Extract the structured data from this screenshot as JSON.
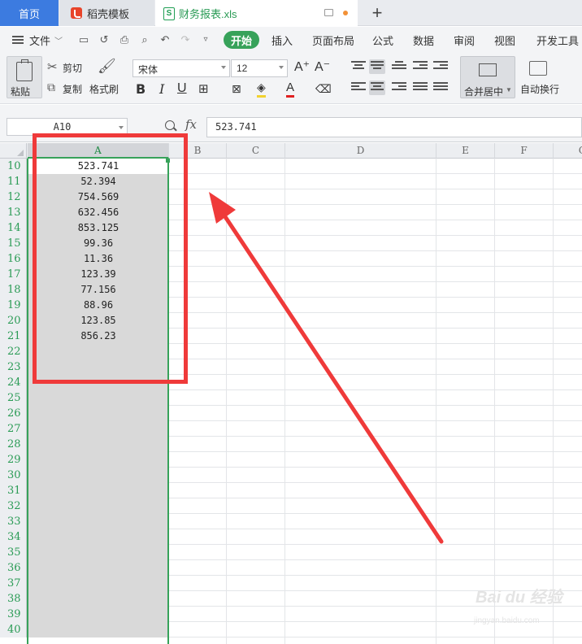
{
  "tabs": {
    "home": "首页",
    "template": "稻壳模板",
    "file": "财务报表.xls",
    "add": "+"
  },
  "menu": {
    "file": "文件",
    "start": "开始",
    "insert": "插入",
    "layout": "页面布局",
    "formula": "公式",
    "data": "数据",
    "review": "审阅",
    "view": "视图",
    "dev": "开发工具"
  },
  "ribbon": {
    "paste": "粘贴",
    "cut": "剪切",
    "copy": "复制",
    "format_painter": "格式刷",
    "font_name": "宋体",
    "font_size": "12",
    "bold": "B",
    "italic": "I",
    "underline": "U",
    "merge_center": "合并居中",
    "wrap_text": "自动换行",
    "font_color_letter": "A",
    "grow_font": "A⁺",
    "shrink_font": "A⁻"
  },
  "formula_bar": {
    "name_box": "A10",
    "fx": "fx",
    "value": "523.741"
  },
  "columns": [
    "A",
    "B",
    "C",
    "D",
    "E",
    "F",
    "G"
  ],
  "rows": [
    {
      "num": "10",
      "a": "523.741"
    },
    {
      "num": "11",
      "a": "52.394"
    },
    {
      "num": "12",
      "a": "754.569"
    },
    {
      "num": "13",
      "a": "632.456"
    },
    {
      "num": "14",
      "a": "853.125"
    },
    {
      "num": "15",
      "a": "99.36"
    },
    {
      "num": "16",
      "a": "11.36"
    },
    {
      "num": "17",
      "a": "123.39"
    },
    {
      "num": "18",
      "a": "77.156"
    },
    {
      "num": "19",
      "a": "88.96"
    },
    {
      "num": "20",
      "a": "123.85"
    },
    {
      "num": "21",
      "a": "856.23"
    },
    {
      "num": "22",
      "a": ""
    },
    {
      "num": "23",
      "a": ""
    },
    {
      "num": "24",
      "a": ""
    },
    {
      "num": "25",
      "a": ""
    },
    {
      "num": "26",
      "a": ""
    },
    {
      "num": "27",
      "a": ""
    },
    {
      "num": "28",
      "a": ""
    },
    {
      "num": "29",
      "a": ""
    },
    {
      "num": "30",
      "a": ""
    },
    {
      "num": "31",
      "a": ""
    },
    {
      "num": "32",
      "a": ""
    },
    {
      "num": "33",
      "a": ""
    },
    {
      "num": "34",
      "a": ""
    },
    {
      "num": "35",
      "a": ""
    },
    {
      "num": "36",
      "a": ""
    },
    {
      "num": "37",
      "a": ""
    },
    {
      "num": "38",
      "a": ""
    },
    {
      "num": "39",
      "a": ""
    },
    {
      "num": "40",
      "a": ""
    }
  ],
  "watermark": {
    "main": "Bai du 经验",
    "sub": "jingyan.baidu.com"
  },
  "colors": {
    "accent_green": "#37a25a",
    "home_tab_blue": "#3c7be0",
    "annotation_red": "#ef3a3a"
  }
}
